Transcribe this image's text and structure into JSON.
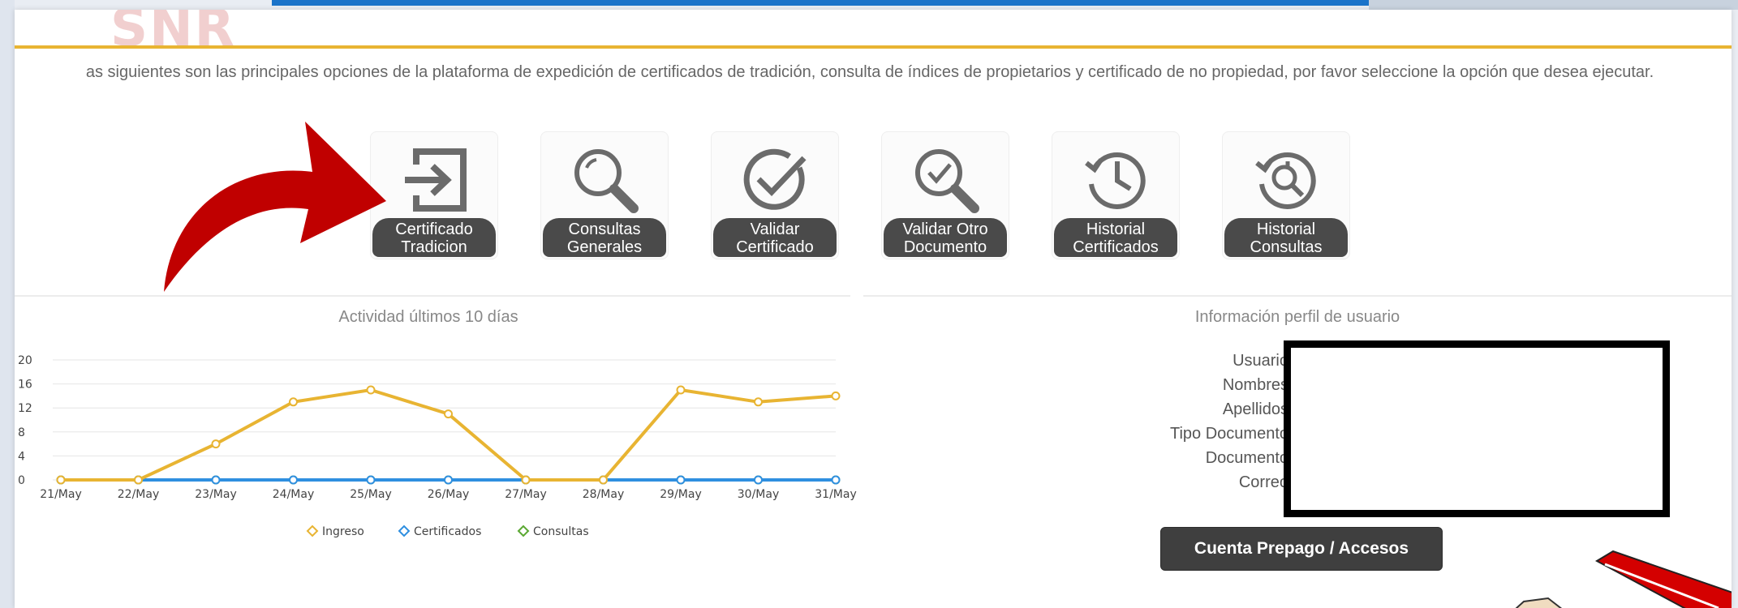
{
  "header": {
    "logo_text": "SNR"
  },
  "intro": {
    "text": "as siguientes son las principales opciones de la plataforma de expedición de certificados de tradición, consulta de índices de propietarios y certificado de no propiedad, por favor seleccione la opción que desea ejecutar."
  },
  "tiles": [
    {
      "line1": "Certificado",
      "line2": "Tradicion",
      "icon": "login-arrow-icon"
    },
    {
      "line1": "Consultas",
      "line2": "Generales",
      "icon": "search-icon"
    },
    {
      "line1": "Validar",
      "line2": "Certificado",
      "icon": "check-circle-icon"
    },
    {
      "line1": "Validar Otro",
      "line2": "Documento",
      "icon": "search-check-icon"
    },
    {
      "line1": "Historial",
      "line2": "Certificados",
      "icon": "history-icon"
    },
    {
      "line1": "Historial",
      "line2": "Consultas",
      "icon": "history-search-icon"
    }
  ],
  "activity": {
    "title": "Actividad últimos 10 días"
  },
  "chart_data": {
    "type": "line",
    "title": "Actividad últimos 10 días",
    "categories": [
      "21/May",
      "22/May",
      "23/May",
      "24/May",
      "25/May",
      "26/May",
      "27/May",
      "28/May",
      "29/May",
      "30/May",
      "31/May"
    ],
    "yticks": [
      "0",
      "4",
      "8",
      "12",
      "16",
      "20"
    ],
    "ylim": [
      0,
      20
    ],
    "grid": true,
    "legend_position": "bottom",
    "series": [
      {
        "name": "Ingreso",
        "color": "#e8b432",
        "values": [
          0,
          0,
          6,
          13,
          15,
          11,
          0,
          0,
          15,
          13,
          14
        ]
      },
      {
        "name": "Certificados",
        "color": "#2f8fe0",
        "values": [
          0,
          0,
          0,
          0,
          0,
          0,
          0,
          0,
          0,
          0,
          0
        ]
      },
      {
        "name": "Consultas",
        "color": "#5aa832",
        "values": [
          0,
          0,
          0,
          0,
          0,
          0,
          0,
          0,
          0,
          0,
          0
        ]
      }
    ]
  },
  "profile": {
    "title": "Información perfil de usuario",
    "labels": [
      "Usuario",
      "Nombres",
      "Apellidos",
      "Tipo Documento",
      "Documento",
      "Correo"
    ],
    "button_label": "Cuenta Prepago / Accesos"
  },
  "colors": {
    "accent_gold": "#e8b432",
    "top_blue": "#1a73c9",
    "tile_label_bg": "#4a4a4a",
    "annotation_arrow": "#c00000"
  }
}
